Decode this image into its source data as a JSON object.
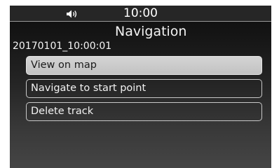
{
  "status_bar": {
    "volume_icon": "speaker-volume-icon",
    "time": "10:00"
  },
  "header": {
    "title": "Navigation",
    "track_name": "20170101_10:00:01"
  },
  "menu": {
    "selected_index": 0,
    "items": [
      {
        "label": "View on map"
      },
      {
        "label": "Navigate to start point"
      },
      {
        "label": "Delete track"
      }
    ]
  },
  "colors": {
    "background_dark": "#0e0e0e",
    "background_light": "#454545",
    "selected_item": "#c8c8c8",
    "text": "#ffffff"
  }
}
